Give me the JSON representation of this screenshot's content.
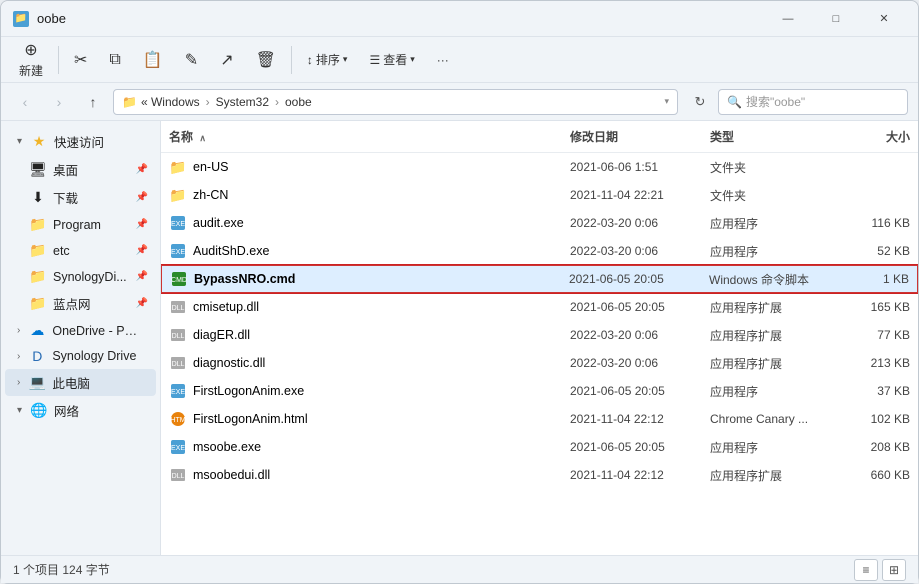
{
  "window": {
    "title": "oobe",
    "controls": {
      "minimize": "—",
      "maximize": "□",
      "close": "✕"
    }
  },
  "toolbar": {
    "new_label": "新建",
    "cut_label": "✂",
    "copy_label": "⧉",
    "paste_label": "⬜",
    "rename_label": "⬚",
    "share_label": "⬒",
    "delete_label": "🗑",
    "sort_label": "排序",
    "view_label": "查看",
    "more_label": "···"
  },
  "addressbar": {
    "path": [
      "Windows",
      "System32",
      "oobe"
    ],
    "search_placeholder": "搜索\"oobe\""
  },
  "sidebar": {
    "quick_access_label": "快速访问",
    "items": [
      {
        "id": "desktop",
        "label": "桌面",
        "icon": "🖥",
        "pinned": true
      },
      {
        "id": "downloads",
        "label": "下载",
        "icon": "⬇",
        "pinned": true
      },
      {
        "id": "program",
        "label": "Program",
        "icon": "📁",
        "pinned": true
      },
      {
        "id": "etc",
        "label": "etc",
        "icon": "📁",
        "pinned": true
      },
      {
        "id": "synology",
        "label": "SynologyDi...",
        "icon": "📁",
        "pinned": true
      },
      {
        "id": "bluelink",
        "label": "蓝点网",
        "icon": "📁",
        "pinned": true
      }
    ],
    "onedrive_label": "OneDrive - Pers...",
    "synology_drive_label": "Synology Drive",
    "this_pc_label": "此电脑",
    "network_label": "网络"
  },
  "columns": {
    "name": "名称",
    "date": "修改日期",
    "type": "类型",
    "size": "大小",
    "sort_arrow": "∧"
  },
  "files": [
    {
      "id": "en-US",
      "name": "en-US",
      "date": "2021-06-06 1:51",
      "type": "文件夹",
      "size": "",
      "icon_type": "folder",
      "selected": false
    },
    {
      "id": "zh-CN",
      "name": "zh-CN",
      "date": "2021-11-04 22:21",
      "type": "文件夹",
      "size": "",
      "icon_type": "folder",
      "selected": false
    },
    {
      "id": "audit",
      "name": "audit.exe",
      "date": "2022-03-20 0:06",
      "type": "应用程序",
      "size": "116 KB",
      "icon_type": "exe",
      "selected": false
    },
    {
      "id": "auditshd",
      "name": "AuditShD.exe",
      "date": "2022-03-20 0:06",
      "type": "应用程序",
      "size": "52 KB",
      "icon_type": "exe",
      "selected": false
    },
    {
      "id": "bypassnro",
      "name": "BypassNRO.cmd",
      "date": "2021-06-05 20:05",
      "type": "Windows 命令脚本",
      "size": "1 KB",
      "icon_type": "cmd",
      "selected": true
    },
    {
      "id": "cmisetup",
      "name": "cmisetup.dll",
      "date": "2021-06-05 20:05",
      "type": "应用程序扩展",
      "size": "165 KB",
      "icon_type": "dll",
      "selected": false
    },
    {
      "id": "diager",
      "name": "diagER.dll",
      "date": "2022-03-20 0:06",
      "type": "应用程序扩展",
      "size": "77 KB",
      "icon_type": "dll",
      "selected": false
    },
    {
      "id": "diagnostic",
      "name": "diagnostic.dll",
      "date": "2022-03-20 0:06",
      "type": "应用程序扩展",
      "size": "213 KB",
      "icon_type": "dll",
      "selected": false
    },
    {
      "id": "firstlogonanim",
      "name": "FirstLogonAnim.exe",
      "date": "2021-06-05 20:05",
      "type": "应用程序",
      "size": "37 KB",
      "icon_type": "exe",
      "selected": false
    },
    {
      "id": "firstlogonhtml",
      "name": "FirstLogonAnim.html",
      "date": "2021-11-04 22:12",
      "type": "Chrome Canary ...",
      "size": "102 KB",
      "icon_type": "html",
      "selected": false
    },
    {
      "id": "msoobe",
      "name": "msoobe.exe",
      "date": "2021-06-05 20:05",
      "type": "应用程序",
      "size": "208 KB",
      "icon_type": "exe",
      "selected": false
    },
    {
      "id": "msoobedui",
      "name": "msoobedui.dll",
      "date": "2021-11-04 22:12",
      "type": "应用程序扩展",
      "size": "660 KB",
      "icon_type": "dll",
      "selected": false
    }
  ],
  "statusbar": {
    "selection_text": "个项目 124 字节",
    "selection_prefix": "1"
  }
}
